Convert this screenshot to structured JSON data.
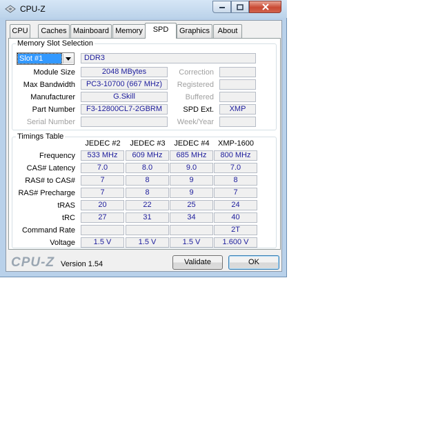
{
  "window": {
    "title": "CPU-Z"
  },
  "tabs": [
    "CPU",
    "Caches",
    "Mainboard",
    "Memory",
    "SPD",
    "Graphics",
    "About"
  ],
  "active_tab": "SPD",
  "memory_slot_selection": {
    "group_title": "Memory Slot Selection",
    "slot_value": "Slot #1",
    "memory_type": "DDR3",
    "module_size_label": "Module Size",
    "module_size": "2048 MBytes",
    "max_bandwidth_label": "Max Bandwidth",
    "max_bandwidth": "PC3-10700 (667 MHz)",
    "manufacturer_label": "Manufacturer",
    "manufacturer": "G.Skill",
    "part_number_label": "Part Number",
    "part_number": "F3-12800CL7-2GBRM",
    "serial_number_label": "Serial Number",
    "serial_number": "",
    "correction_label": "Correction",
    "registered_label": "Registered",
    "buffered_label": "Buffered",
    "spd_ext_label": "SPD Ext.",
    "spd_ext": "XMP",
    "week_year_label": "Week/Year"
  },
  "timings": {
    "group_title": "Timings Table",
    "columns": [
      "JEDEC #2",
      "JEDEC #3",
      "JEDEC #4",
      "XMP-1600"
    ],
    "rows": [
      {
        "label": "Frequency",
        "values": [
          "533 MHz",
          "609 MHz",
          "685 MHz",
          "800 MHz"
        ]
      },
      {
        "label": "CAS# Latency",
        "values": [
          "7.0",
          "8.0",
          "9.0",
          "7.0"
        ]
      },
      {
        "label": "RAS# to CAS#",
        "values": [
          "7",
          "8",
          "9",
          "8"
        ]
      },
      {
        "label": "RAS# Precharge",
        "values": [
          "7",
          "8",
          "9",
          "7"
        ]
      },
      {
        "label": "tRAS",
        "values": [
          "20",
          "22",
          "25",
          "24"
        ]
      },
      {
        "label": "tRC",
        "values": [
          "27",
          "31",
          "34",
          "40"
        ]
      },
      {
        "label": "Command Rate",
        "values": [
          "",
          "",
          "",
          "2T"
        ]
      },
      {
        "label": "Voltage",
        "values": [
          "1.5 V",
          "1.5 V",
          "1.5 V",
          "1.600 V"
        ]
      }
    ]
  },
  "footer": {
    "brand": "CPU-Z",
    "version": "Version 1.54",
    "validate_label": "Validate",
    "ok_label": "OK"
  },
  "colors": {
    "value_text": "#1c1c9c",
    "title_bar": "#bcd3ea",
    "close_button": "#c94a34"
  }
}
